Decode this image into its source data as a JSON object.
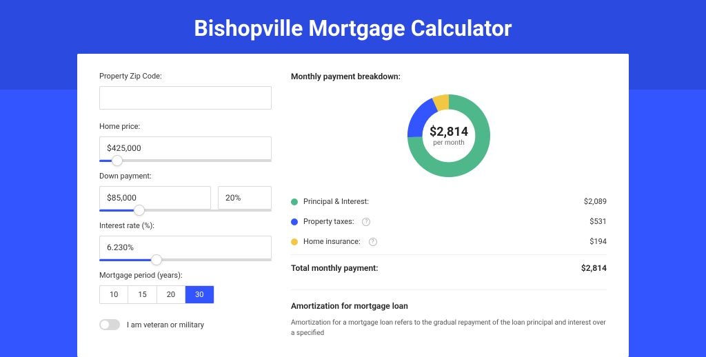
{
  "header": {
    "title": "Bishopville Mortgage Calculator"
  },
  "form": {
    "zip_label": "Property Zip Code:",
    "zip_value": "",
    "home_label": "Home price:",
    "home_value": "$425,000",
    "home_slider_pct": 7,
    "down_label": "Down payment:",
    "down_amount": "$85,000",
    "down_pct": "20%",
    "down_slider_pct": 20,
    "rate_label": "Interest rate (%):",
    "rate_value": "6.230%",
    "rate_slider_pct": 30,
    "period_label": "Mortgage period (years):",
    "periods": [
      "10",
      "15",
      "20",
      "30"
    ],
    "period_active": 3,
    "vet_label": "I am veteran or military"
  },
  "breakdown": {
    "title": "Monthly payment breakdown:",
    "donut": {
      "amount": "$2,814",
      "sub": "per month"
    },
    "items": [
      {
        "color": "green",
        "label": "Principal & Interest:",
        "value": "$2,089",
        "info": false
      },
      {
        "color": "blue",
        "label": "Property taxes:",
        "value": "$531",
        "info": true
      },
      {
        "color": "yellow",
        "label": "Home insurance:",
        "value": "$194",
        "info": true
      }
    ],
    "total_label": "Total monthly payment:",
    "total_value": "$2,814"
  },
  "amort": {
    "title": "Amortization for mortgage loan",
    "text": "Amortization for a mortgage loan refers to the gradual repayment of the loan principal and interest over a specified"
  },
  "chart_data": {
    "type": "pie",
    "title": "Monthly payment breakdown",
    "series": [
      {
        "name": "Principal & Interest",
        "value": 2089,
        "color": "#4eb88a"
      },
      {
        "name": "Property taxes",
        "value": 531,
        "color": "#3355ff"
      },
      {
        "name": "Home insurance",
        "value": 194,
        "color": "#f2c744"
      }
    ],
    "total": 2814
  }
}
